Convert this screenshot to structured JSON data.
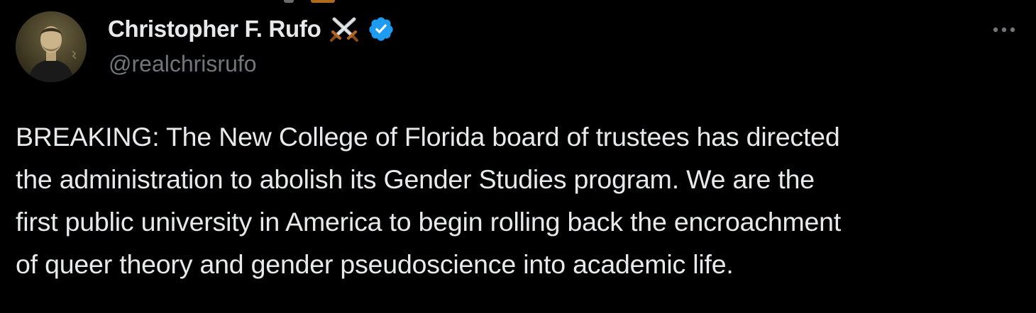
{
  "author": {
    "display_name": "Christopher F. Rufo",
    "handle": "@realchrisrufo",
    "name_emoji": "crossed-swords-emoji",
    "verified": true,
    "avatar": "profile-photo"
  },
  "tweet": {
    "lines": [
      "BREAKING: The New College of Florida board of trustees has directed",
      "the administration to abolish its Gender Studies program. We are the",
      "first public university in America to begin rolling back the encroachment",
      "of queer theory and gender pseudoscience into academic life."
    ]
  },
  "actions": {
    "more_icon": "more-horizontal-icon"
  },
  "colors": {
    "background": "#000000",
    "primary_text": "#e7e9ea",
    "secondary_text": "#71767b",
    "verified_badge": "#1d9bf0"
  }
}
